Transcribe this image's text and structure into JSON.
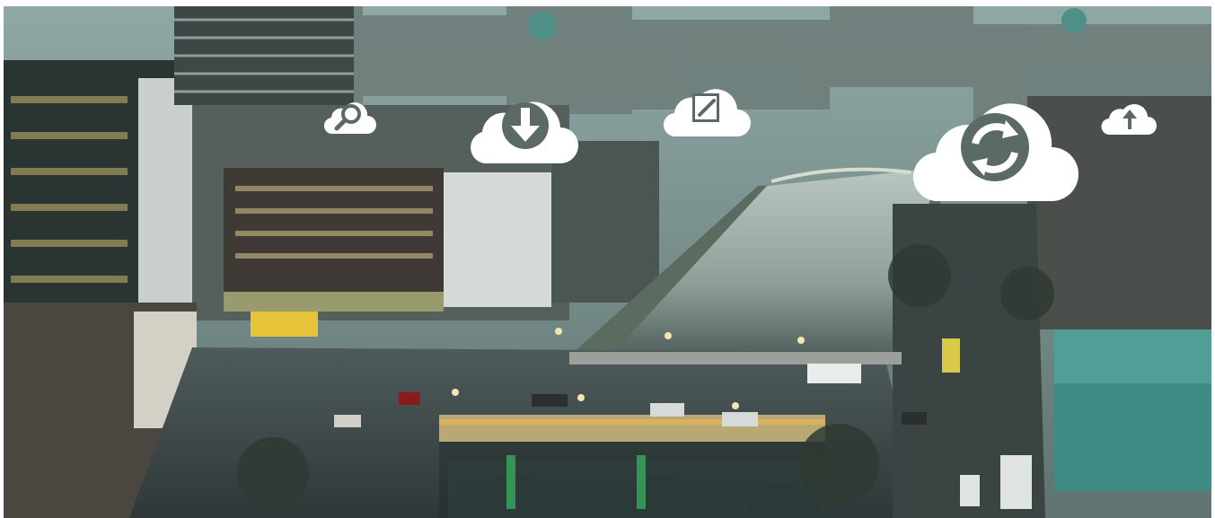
{
  "scene": {
    "subject": "aerial-city-river-bridge",
    "accent_sky": "#9fb9b8",
    "water_color": "#8c9a98",
    "cloud_icon_color": "#ffffff"
  },
  "icons": [
    {
      "name": "cloud-search-icon"
    },
    {
      "name": "cloud-download-icon"
    },
    {
      "name": "cloud-edit-icon"
    },
    {
      "name": "cloud-sync-icon"
    },
    {
      "name": "cloud-upload-icon"
    }
  ]
}
